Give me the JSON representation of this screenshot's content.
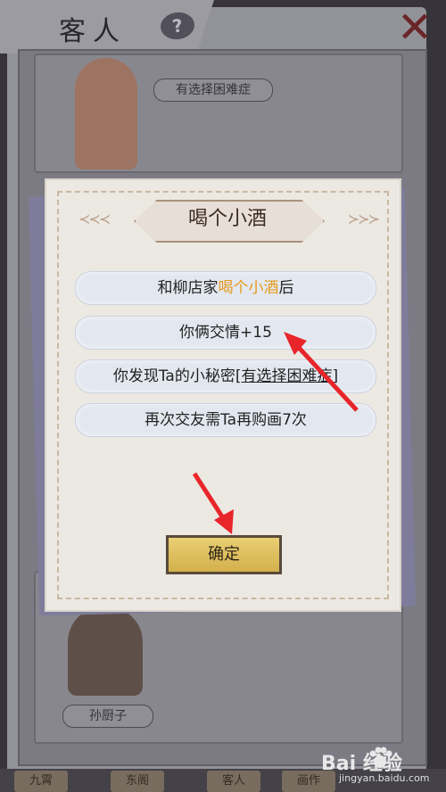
{
  "header": {
    "title": "客人",
    "help_glyph": "?",
    "close_glyph": "✕"
  },
  "background": {
    "top_tag": "有选择困难症",
    "bottom_tag": "孙厨子",
    "nav": [
      "九霄",
      "东阁",
      "客人",
      "画作"
    ]
  },
  "dialog": {
    "title": "喝个小酒",
    "line1_prefix": "和柳店家",
    "line1_highlight": "喝个小酒",
    "line1_suffix": "后",
    "line2": "你俩交情+15",
    "line3_prefix": "你发现Ta的小秘密",
    "line3_link": "[有选择困难症]",
    "line4": "再次交友需Ta再购画7次",
    "confirm": "确定"
  },
  "colors": {
    "highlight": "#e59a1a",
    "arrow": "#e8252a",
    "button": "#d9b95b"
  },
  "watermark": {
    "brand": "Bai 经验",
    "url": "jingyan.baidu.com"
  }
}
